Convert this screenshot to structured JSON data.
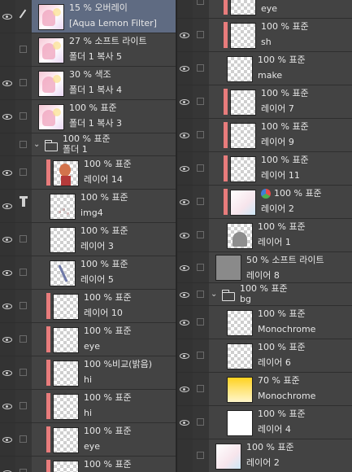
{
  "left_layers": [
    {
      "mode": "15 % 오버레이",
      "name": "[Aqua Lemon Filter]",
      "thumb": "anime",
      "eye": true,
      "selected": true,
      "clip": false,
      "indent": 0,
      "extra_icon": "pen"
    },
    {
      "mode": "27 % 소프트 라이트",
      "name": "폴더 1 복사 5",
      "thumb": "anime",
      "eye": false,
      "selected": false,
      "clip": false,
      "indent": 0
    },
    {
      "mode": "30 % 색조",
      "name": "폴더 1 복사 4",
      "thumb": "anime",
      "eye": true,
      "selected": false,
      "clip": false,
      "indent": 0
    },
    {
      "mode": "100 % 표준",
      "name": "폴더 1 복사 3",
      "thumb": "anime",
      "eye": true,
      "selected": false,
      "clip": false,
      "indent": 0
    },
    {
      "mode": "100 % 표준",
      "name": "폴더 1",
      "folder": true,
      "eye": false,
      "selected": false,
      "clip": false,
      "indent": 0
    },
    {
      "mode": "100 % 표준",
      "name": "레이어 14",
      "thumb": "figure",
      "eye": true,
      "selected": false,
      "clip": true,
      "indent": 1
    },
    {
      "mode": "100 % 표준",
      "name": "img4",
      "thumb": "dots",
      "eye": true,
      "selected": false,
      "clip": false,
      "indent": 1,
      "extra_icon": "lighthouse"
    },
    {
      "mode": "100 % 표준",
      "name": "레이어 3",
      "thumb": "checker",
      "eye": true,
      "selected": false,
      "clip": false,
      "indent": 1
    },
    {
      "mode": "100 % 표준",
      "name": "레이어 5",
      "thumb": "stroke",
      "eye": true,
      "selected": false,
      "clip": false,
      "indent": 1
    },
    {
      "mode": "100 % 표준",
      "name": "레이어 10",
      "thumb": "checker",
      "eye": true,
      "selected": false,
      "clip": true,
      "indent": 1
    },
    {
      "mode": "100 % 표준",
      "name": "eye",
      "thumb": "checker",
      "eye": true,
      "selected": false,
      "clip": true,
      "indent": 1
    },
    {
      "mode": "100 %비교(밝음)",
      "name": "hi",
      "thumb": "checker",
      "eye": true,
      "selected": false,
      "clip": true,
      "indent": 1
    },
    {
      "mode": "100 % 표준",
      "name": "hi",
      "thumb": "checker",
      "eye": true,
      "selected": false,
      "clip": true,
      "indent": 1
    },
    {
      "mode": "100 % 표준",
      "name": "eye",
      "thumb": "checker",
      "eye": true,
      "selected": false,
      "clip": true,
      "indent": 1
    },
    {
      "mode": "100 % 표준",
      "name": "",
      "thumb": "checker",
      "eye": true,
      "selected": false,
      "clip": true,
      "indent": 1
    }
  ],
  "right_layers": [
    {
      "mode": "",
      "name": "eye",
      "thumb": "checker",
      "eye": false,
      "clip": true,
      "indent": 1
    },
    {
      "mode": "100 % 표준",
      "name": "sh",
      "thumb": "checker",
      "eye": true,
      "clip": true,
      "indent": 1
    },
    {
      "mode": "100 % 표준",
      "name": "make",
      "thumb": "checker",
      "eye": true,
      "clip": false,
      "indent": 1
    },
    {
      "mode": "100 % 표준",
      "name": "레이어 7",
      "thumb": "checker",
      "eye": true,
      "clip": true,
      "indent": 1
    },
    {
      "mode": "100 % 표준",
      "name": "레이어 9",
      "thumb": "checker",
      "eye": true,
      "clip": true,
      "indent": 1
    },
    {
      "mode": "100 % 표준",
      "name": "레이어 11",
      "thumb": "checker",
      "eye": true,
      "clip": true,
      "indent": 1
    },
    {
      "mode": "100 % 표준",
      "name": "레이어 2",
      "thumb": "anime-light",
      "eye": true,
      "clip": true,
      "indent": 1,
      "color_icon": true
    },
    {
      "mode": "100 % 표준",
      "name": "레이어 1",
      "thumb": "gray-shape",
      "eye": true,
      "clip": false,
      "indent": 1
    },
    {
      "mode": "50 % 소프트 라이트",
      "name": "레이어 8",
      "thumb": "gray",
      "eye": true,
      "clip": false,
      "indent": 0
    },
    {
      "mode": "100 % 표준",
      "name": "bg",
      "folder": true,
      "eye": true,
      "clip": false,
      "indent": 0
    },
    {
      "mode": "100 % 표준",
      "name": "Monochrome",
      "thumb": "checker",
      "eye": true,
      "clip": false,
      "indent": 1
    },
    {
      "mode": "100 % 표준",
      "name": "레이어 6",
      "thumb": "checker",
      "eye": true,
      "clip": false,
      "indent": 1
    },
    {
      "mode": "70 % 표준",
      "name": "Monochrome",
      "thumb": "yellow",
      "eye": true,
      "clip": false,
      "indent": 1
    },
    {
      "mode": "100 % 표준",
      "name": "레이어 4",
      "thumb": "white",
      "eye": true,
      "clip": false,
      "indent": 1
    },
    {
      "mode": "100 % 표준",
      "name": "레이어 2",
      "thumb": "anime-light",
      "eye": false,
      "clip": false,
      "indent": 0
    }
  ],
  "colors": {
    "clip_bar": "#e87c7c",
    "selected_row": "#5f6b82",
    "panel_bg": "#3a3a3a",
    "row_bg": "#434343"
  }
}
